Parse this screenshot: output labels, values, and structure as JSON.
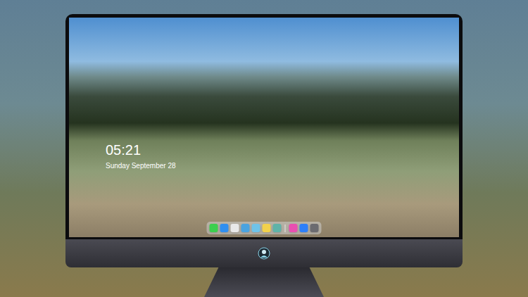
{
  "desktop": {
    "clock": {
      "time": "05:21",
      "date": "Sunday September 28"
    },
    "dock": {
      "items": [
        {
          "kind": "app",
          "color": "#3ccf4e"
        },
        {
          "kind": "app",
          "color": "#2f8ff0"
        },
        {
          "kind": "app",
          "color": "#e8e8e8"
        },
        {
          "kind": "app",
          "color": "#4aa3df"
        },
        {
          "kind": "app",
          "color": "#6fc3e8"
        },
        {
          "kind": "app",
          "color": "#f2d14b"
        },
        {
          "kind": "app",
          "color": "#5fb3a8"
        },
        {
          "kind": "separator",
          "color": "#ffffff"
        },
        {
          "kind": "app",
          "color": "#e94fb0"
        },
        {
          "kind": "app",
          "color": "#2d7ff9"
        },
        {
          "kind": "app",
          "color": "#6b6b70"
        }
      ]
    }
  }
}
